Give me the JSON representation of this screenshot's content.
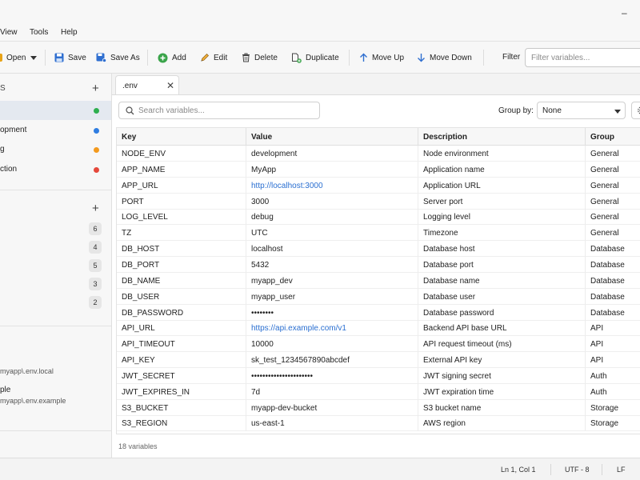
{
  "menu": [
    "View",
    "Tools",
    "Help"
  ],
  "toolbar": {
    "open": "Open",
    "save": "Save",
    "save_as": "Save As",
    "add": "Add",
    "edit": "Edit",
    "delete": "Delete",
    "duplicate": "Duplicate",
    "move_up": "Move Up",
    "move_down": "Move Down",
    "filter_label": "Filter",
    "filter_placeholder": "Filter variables..."
  },
  "sidebar": {
    "environments_header": "S",
    "environments": [
      {
        "label": "",
        "color": "#2eaf4f",
        "active": true
      },
      {
        "label": "opment",
        "color": "#2f7de1",
        "active": false
      },
      {
        "label": "g",
        "color": "#f39a1e",
        "active": false
      },
      {
        "label": "ction",
        "color": "#e5483b",
        "active": false
      }
    ],
    "groups": [
      {
        "label": "",
        "count": "6"
      },
      {
        "label": "",
        "count": "4"
      },
      {
        "label": "",
        "count": "5"
      },
      {
        "label": "",
        "count": "3"
      },
      {
        "label": "",
        "count": "2"
      }
    ],
    "recent": [
      {
        "name": "",
        "path": "myapp\\.env.local"
      },
      {
        "name": "ple",
        "path": "myapp\\.env.example"
      }
    ]
  },
  "tab": {
    "name": ".env"
  },
  "panel": {
    "search_placeholder": "Search variables...",
    "group_by_label": "Group by:",
    "group_by_value": "None",
    "variable_count": "18 variables"
  },
  "table": {
    "headers": [
      "Key",
      "Value",
      "Description",
      "Group"
    ],
    "rows": [
      {
        "key": "NODE_ENV",
        "value": "development",
        "description": "Node environment",
        "group": "General"
      },
      {
        "key": "APP_NAME",
        "value": "MyApp",
        "description": "Application name",
        "group": "General"
      },
      {
        "key": "APP_URL",
        "value": "http://localhost:3000",
        "description": "Application URL",
        "group": "General",
        "link": true
      },
      {
        "key": "PORT",
        "value": "3000",
        "description": "Server port",
        "group": "General"
      },
      {
        "key": "LOG_LEVEL",
        "value": "debug",
        "description": "Logging level",
        "group": "General"
      },
      {
        "key": "TZ",
        "value": "UTC",
        "description": "Timezone",
        "group": "General"
      },
      {
        "key": "DB_HOST",
        "value": "localhost",
        "description": "Database host",
        "group": "Database"
      },
      {
        "key": "DB_PORT",
        "value": "5432",
        "description": "Database port",
        "group": "Database"
      },
      {
        "key": "DB_NAME",
        "value": "myapp_dev",
        "description": "Database name",
        "group": "Database"
      },
      {
        "key": "DB_USER",
        "value": "myapp_user",
        "description": "Database user",
        "group": "Database"
      },
      {
        "key": "DB_PASSWORD",
        "value": "••••••••",
        "description": "Database password",
        "group": "Database",
        "secret": true
      },
      {
        "key": "API_URL",
        "value": "https://api.example.com/v1",
        "description": "Backend API base URL",
        "group": "API",
        "link": true
      },
      {
        "key": "API_TIMEOUT",
        "value": "10000",
        "description": "API request timeout (ms)",
        "group": "API"
      },
      {
        "key": "API_KEY",
        "value": "sk_test_1234567890abcdef",
        "description": "External API key",
        "group": "API"
      },
      {
        "key": "JWT_SECRET",
        "value": "••••••••••••••••••••••",
        "description": "JWT signing secret",
        "group": "Auth",
        "secret": true
      },
      {
        "key": "JWT_EXPIRES_IN",
        "value": "7d",
        "description": "JWT expiration time",
        "group": "Auth"
      },
      {
        "key": "S3_BUCKET",
        "value": "myapp-dev-bucket",
        "description": "S3 bucket name",
        "group": "Storage"
      },
      {
        "key": "S3_REGION",
        "value": "us-east-1",
        "description": "AWS region",
        "group": "Storage"
      }
    ]
  },
  "status": {
    "position": "Ln 1, Col 1",
    "encoding": "UTF - 8",
    "eol": "LF"
  }
}
